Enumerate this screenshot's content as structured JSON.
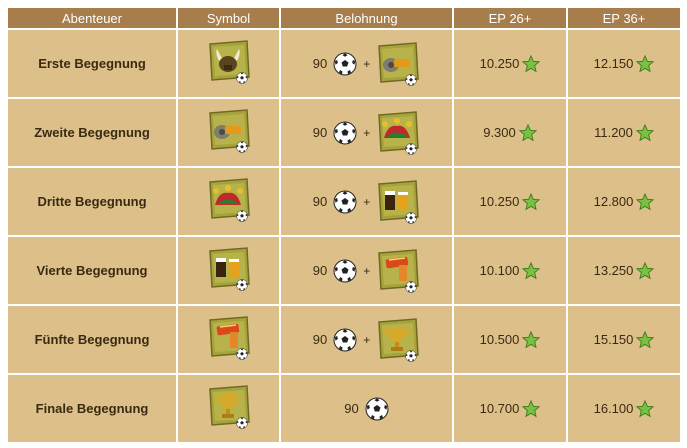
{
  "headers": {
    "adventure": "Abenteuer",
    "symbol": "Symbol",
    "reward": "Belohnung",
    "ep26": "EP 26+",
    "ep36": "EP 36+"
  },
  "plus": "+",
  "rows": [
    {
      "name": "Erste Begegnung",
      "symbol": "helmet-icon",
      "coins": "90",
      "reward_item": "whistle-icon",
      "ep26": "10.250",
      "ep36": "12.150"
    },
    {
      "name": "Zweite Begegnung",
      "symbol": "whistle-icon",
      "coins": "90",
      "reward_item": "jester-hat-icon",
      "ep26": "9.300",
      "ep36": "11.200"
    },
    {
      "name": "Dritte Begegnung",
      "symbol": "jester-hat-icon",
      "coins": "90",
      "reward_item": "beer-icon",
      "ep26": "10.250",
      "ep36": "12.800"
    },
    {
      "name": "Vierte Begegnung",
      "symbol": "beer-icon",
      "coins": "90",
      "reward_item": "scarf-icon",
      "ep26": "10.100",
      "ep36": "13.250"
    },
    {
      "name": "Fünfte Begegnung",
      "symbol": "scarf-icon",
      "coins": "90",
      "reward_item": "trophy-icon",
      "ep26": "10.500",
      "ep36": "15.150"
    },
    {
      "name": "Finale Begegnung",
      "symbol": "trophy-icon",
      "coins": "90",
      "reward_item": null,
      "ep26": "10.700",
      "ep36": "16.100"
    }
  ],
  "colors": {
    "header": "#a77d4c",
    "cell": "#ddc089",
    "card": "#a6a33c",
    "star": "#7ac043"
  }
}
